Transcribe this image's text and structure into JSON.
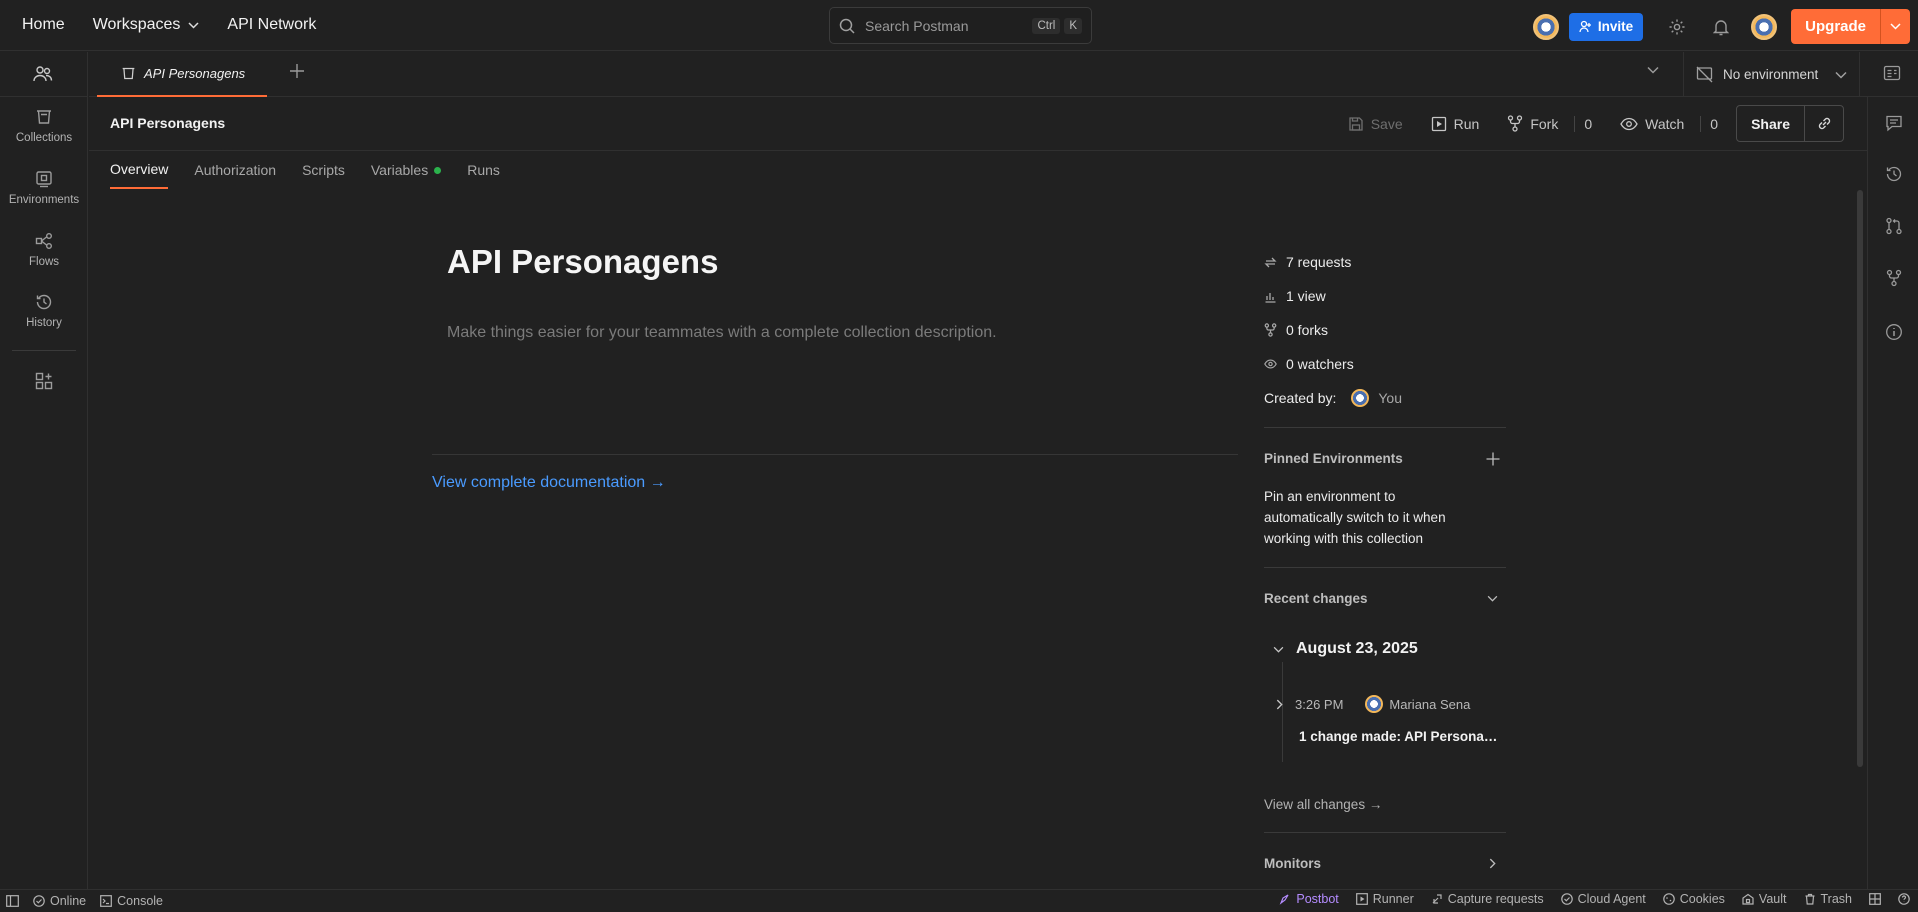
{
  "topbar": {
    "nav": {
      "home": "Home",
      "workspaces": "Workspaces",
      "api_network": "API Network"
    },
    "search": {
      "placeholder": "Search Postman",
      "kbd1": "Ctrl",
      "kbd2": "K"
    },
    "invite": "Invite",
    "upgrade": "Upgrade"
  },
  "sidebar": {
    "items": [
      {
        "label": "Collections",
        "icon": "collections-icon"
      },
      {
        "label": "Environments",
        "icon": "environments-icon"
      },
      {
        "label": "Flows",
        "icon": "flows-icon"
      },
      {
        "label": "History",
        "icon": "history-icon"
      }
    ]
  },
  "tabs": {
    "active_tab": "API Personagens",
    "environment": "No environment"
  },
  "collection": {
    "name": "API Personagens",
    "actions": {
      "save": "Save",
      "run": "Run",
      "fork": "Fork",
      "fork_count": "0",
      "watch": "Watch",
      "watch_count": "0",
      "share": "Share"
    },
    "subtabs": [
      "Overview",
      "Authorization",
      "Scripts",
      "Variables",
      "Runs"
    ],
    "title": "API Personagens",
    "description_placeholder": "Make things easier for your teammates with a complete collection description.",
    "docs_link": "View complete documentation →"
  },
  "info": {
    "stats": [
      "7 requests",
      "1 view",
      "0 forks",
      "0 watchers"
    ],
    "created_by_label": "Created by:",
    "created_by_value": "You",
    "pinned": {
      "title": "Pinned Environments",
      "description": "Pin an environment to automatically switch to it when working with this collection"
    },
    "recent": {
      "title": "Recent changes",
      "date": "August 23, 2025",
      "time": "3:26 PM",
      "user": "Mariana Sena",
      "summary_prefix": "1 change made: ",
      "summary_target": "API Personagens",
      "view_all": "View all changes →"
    },
    "monitors": "Monitors"
  },
  "statusbar": {
    "online": "Online",
    "console": "Console",
    "postbot": "Postbot",
    "runner": "Runner",
    "capture": "Capture requests",
    "cloud_agent": "Cloud Agent",
    "cookies": "Cookies",
    "vault": "Vault",
    "trash": "Trash"
  },
  "colors": {
    "accent": "#ff6c37",
    "invite": "#1e6ee6",
    "link": "#4a9bff",
    "variables_dot": "#2bb24c",
    "postbot": "#b48cff"
  }
}
